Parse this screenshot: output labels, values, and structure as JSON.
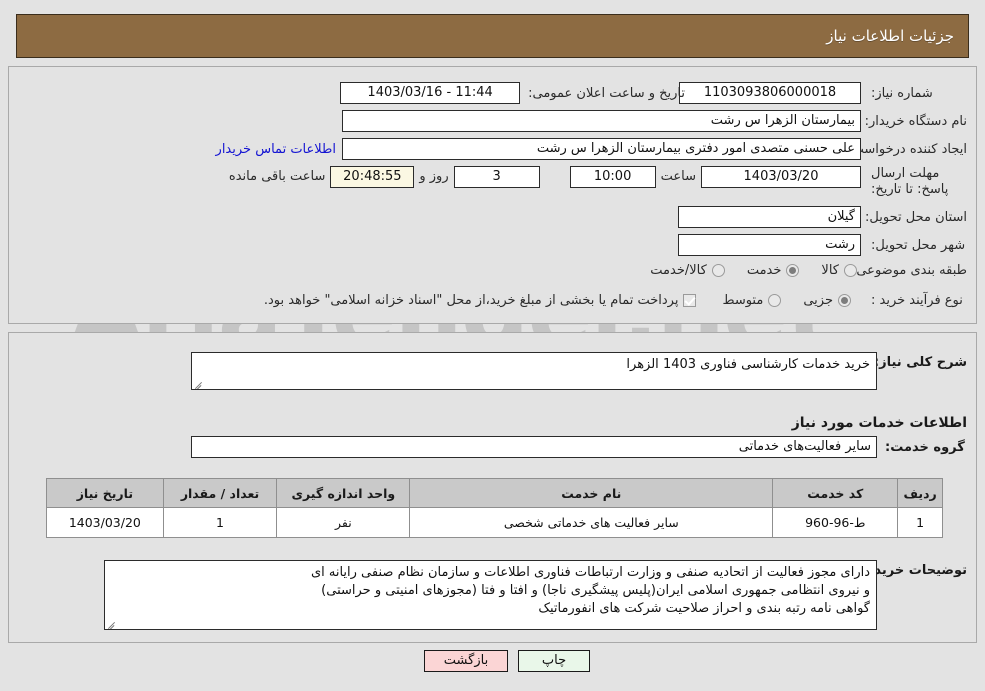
{
  "header": {
    "title": "جزئیات اطلاعات نیاز"
  },
  "watermark": {
    "text": "AriaTender.net",
    "logo_color": "#d99a9a",
    "text_color": "#9a9a9a"
  },
  "form": {
    "need_number": {
      "label": "شماره نیاز:",
      "value": "1103093806000018"
    },
    "announce_datetime": {
      "label": "تاریخ و ساعت اعلان عمومی:",
      "value": "11:44 - 1403/03/16"
    },
    "buyer_org": {
      "label": "نام دستگاه خریدار:",
      "value": "بیمارستان الزهرا  س  رشت"
    },
    "requester": {
      "label": "ایجاد کننده درخواست:",
      "value": "علی حسنی متصدی امور دفتری بیمارستان الزهرا  س  رشت"
    },
    "contact_link": {
      "label": "اطلاعات تماس خریدار"
    },
    "deadline": {
      "label": "مهلت ارسال پاسخ: تا تاریخ:",
      "date": "1403/03/20",
      "time_label": "ساعت",
      "time": "10:00",
      "days": "3",
      "days_suffix": "روز و",
      "countdown": "20:48:55",
      "countdown_suffix": "ساعت باقی مانده"
    },
    "province": {
      "label": "استان محل تحویل:",
      "value": "گیلان"
    },
    "city": {
      "label": "شهر محل تحویل:",
      "value": "رشت"
    },
    "category": {
      "label": "طبقه بندی موضوعی:",
      "options": [
        {
          "label": "کالا",
          "selected": false
        },
        {
          "label": "خدمت",
          "selected": true
        },
        {
          "label": "کالا/خدمت",
          "selected": false
        }
      ]
    },
    "purchase_type": {
      "label": "نوع فرآیند خرید :",
      "options": [
        {
          "label": "جزیی",
          "selected": true
        },
        {
          "label": "متوسط",
          "selected": false
        }
      ]
    },
    "treasury_note": {
      "checked": true,
      "text": "پرداخت تمام یا بخشی از مبلغ خرید،از محل \"اسناد خزانه اسلامی\" خواهد بود."
    }
  },
  "detail": {
    "general_desc": {
      "label": "شرح کلی نیاز:",
      "value": "خرید خدمات کارشناسی فناوری 1403 الزهرا"
    },
    "services_heading": "اطلاعات خدمات مورد نیاز",
    "service_group": {
      "label": "گروه خدمت:",
      "value": "سایر فعالیت‌های خدماتی"
    },
    "table": {
      "headers": [
        "ردیف",
        "کد خدمت",
        "نام خدمت",
        "واحد اندازه گیری",
        "تعداد / مقدار",
        "تاریخ نیاز"
      ],
      "rows": [
        {
          "index": "1",
          "service_code": "ط-96-960",
          "service_name": "سایر فعالیت های خدماتی شخصی",
          "unit": "نفر",
          "quantity": "1",
          "need_date": "1403/03/20"
        }
      ]
    },
    "buyer_notes": {
      "label": "توضیحات خریدار:",
      "lines": [
        "دارای مجوز فعالیت از اتحادیه صنفی و وزارت ارتباطات فناوری اطلاعات و سازمان نظام صنفی رایانه ای",
        "و نیروی انتظامی جمهوری اسلامی ایران(پلیس پیشگیری ناجا) و افتا و فتا (مجوزهای امنیتی و حراستی)",
        "گواهی نامه رتبه بندی و احراز صلاحیت شرکت های انفورماتیک"
      ]
    }
  },
  "footer": {
    "print_label": "چاپ",
    "back_label": "بازگشت"
  }
}
